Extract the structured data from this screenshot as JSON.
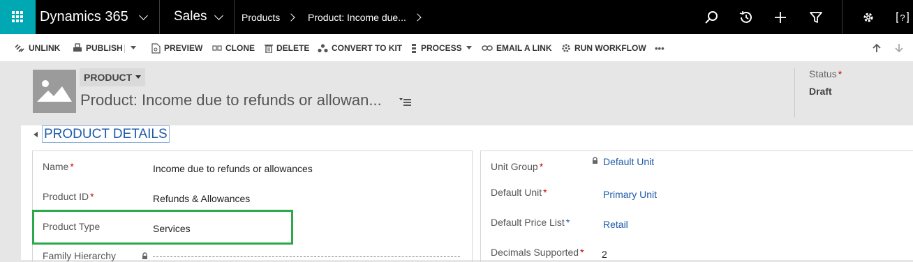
{
  "nav": {
    "app_name": "Dynamics 365",
    "area": "Sales",
    "breadcrumb": [
      "Products",
      "Product: Income due..."
    ]
  },
  "toolbar": {
    "unlink": "UNLINK",
    "publish": "PUBLISH",
    "preview": "PREVIEW",
    "clone": "CLONE",
    "delete": "DELETE",
    "convert_to_kit": "CONVERT TO KIT",
    "process": "PROCESS",
    "email_link": "EMAIL A LINK",
    "run_workflow": "RUN WORKFLOW",
    "more": "•••"
  },
  "header": {
    "entity_label": "PRODUCT",
    "record_title": "Product: Income due to refunds or allowan...",
    "status_label": "Status",
    "status_value": "Draft"
  },
  "section": {
    "title": "PRODUCT DETAILS"
  },
  "left_fields": [
    {
      "label": "Name",
      "required": true,
      "value": "Income due to refunds or allowances"
    },
    {
      "label": "Product ID",
      "required": true,
      "value": "Refunds & Allowances"
    },
    {
      "label": "Product Type",
      "required": false,
      "value": "Services"
    },
    {
      "label": "Family Hierarchy",
      "required": false,
      "value": ""
    }
  ],
  "right_fields": [
    {
      "label": "Unit Group",
      "required": true,
      "value": "Default Unit"
    },
    {
      "label": "Default Unit",
      "required": true,
      "value": "Primary Unit"
    },
    {
      "label": "Default Price List",
      "required": "recommended",
      "value": "Retail"
    },
    {
      "label": "Decimals Supported",
      "required": true,
      "value": "2"
    }
  ],
  "colors": {
    "accent_teal": "#00a8b4",
    "link_blue": "#1e5aa8",
    "required_red": "#cc0000",
    "highlight_green": "#2aa84a"
  },
  "icons": [
    "app-launcher-icon",
    "chevron-down-icon",
    "search-icon",
    "recent-icon",
    "plus-icon",
    "filter-icon",
    "settings-icon",
    "help-icon",
    "arrow-up-icon",
    "arrow-down-icon",
    "lock-icon",
    "image-placeholder-icon",
    "form-selector-icon"
  ]
}
